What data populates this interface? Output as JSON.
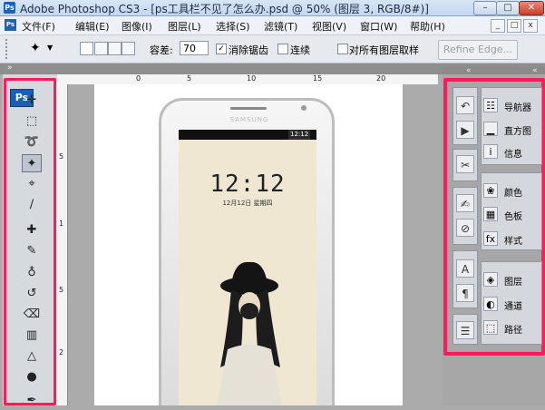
{
  "window": {
    "app_icon": "Ps",
    "title": "Adobe Photoshop CS3 - [ps工具栏不见了怎么办.psd @ 50% (图层 3, RGB/8#)]",
    "controls": [
      "–",
      "□",
      "✕"
    ]
  },
  "menu": {
    "items": [
      "文件(F)",
      "编辑(E)",
      "图像(I)",
      "图层(L)",
      "选择(S)",
      "滤镜(T)",
      "视图(V)",
      "窗口(W)",
      "帮助(H)"
    ],
    "doc_controls": [
      "_",
      "□",
      "x"
    ]
  },
  "options": {
    "tolerance_label": "容差:",
    "tolerance_value": "70",
    "antialias_label": "消除锯齿",
    "antialias_checked": "✓",
    "contiguous_label": "连续",
    "sample_all_label": "对所有图层取样",
    "refine_edge_label": "Refine Edge..."
  },
  "ruler": {
    "top_labels": [
      "0",
      "5",
      "10",
      "15",
      "20"
    ],
    "left_labels": [
      "5",
      "1",
      "5",
      "2"
    ]
  },
  "toolbox": {
    "logo": "Ps",
    "tools": [
      {
        "name": "move-tool-icon",
        "glyph": "✛"
      },
      {
        "name": "marquee-tool-icon",
        "glyph": "⬚"
      },
      {
        "name": "lasso-tool-icon",
        "glyph": "➰"
      },
      {
        "name": "magic-wand-tool-icon",
        "glyph": "✦"
      },
      {
        "name": "crop-tool-icon",
        "glyph": "⌖"
      },
      {
        "name": "slice-tool-icon",
        "glyph": "∕"
      },
      {
        "name": "healing-brush-tool-icon",
        "glyph": "✚"
      },
      {
        "name": "brush-tool-icon",
        "glyph": "✎"
      },
      {
        "name": "clone-stamp-tool-icon",
        "glyph": "♁"
      },
      {
        "name": "history-brush-tool-icon",
        "glyph": "↺"
      },
      {
        "name": "eraser-tool-icon",
        "glyph": "⌫"
      },
      {
        "name": "gradient-tool-icon",
        "glyph": "▥"
      },
      {
        "name": "blur-tool-icon",
        "glyph": "△"
      },
      {
        "name": "dodge-tool-icon",
        "glyph": "●"
      },
      {
        "name": "pen-tool-icon",
        "glyph": "✒"
      }
    ]
  },
  "document": {
    "phone_brand": "SAMSUNG",
    "status_time": "12:12",
    "lock_time": "12:12",
    "lock_date": "12月12日 星期四"
  },
  "panels": {
    "collapse_left": "«",
    "collapse_right": "«",
    "groups": [
      {
        "label": "导航器",
        "icon": "navigator-icon",
        "glyph": "☷"
      },
      {
        "label": "直方图",
        "icon": "histogram-icon",
        "glyph": "▁"
      },
      {
        "label": "信息",
        "icon": "info-icon",
        "glyph": "i"
      },
      {
        "label": "颜色",
        "icon": "color-icon",
        "glyph": "❀"
      },
      {
        "label": "色板",
        "icon": "swatches-icon",
        "glyph": "▦"
      },
      {
        "label": "样式",
        "icon": "styles-icon",
        "glyph": "fx"
      },
      {
        "label": "图层",
        "icon": "layers-icon",
        "glyph": "◈"
      },
      {
        "label": "通道",
        "icon": "channels-icon",
        "glyph": "◐"
      },
      {
        "label": "路径",
        "icon": "paths-icon",
        "glyph": "⬚"
      }
    ],
    "dock_icons": [
      {
        "name": "history-icon",
        "glyph": "↶"
      },
      {
        "name": "actions-icon",
        "glyph": "▶"
      },
      {
        "name": "tool-presets-icon",
        "glyph": "✂"
      },
      {
        "name": "brushes-icon",
        "glyph": "✍"
      },
      {
        "name": "clone-source-icon",
        "glyph": "⊘"
      },
      {
        "name": "character-icon",
        "glyph": "A"
      },
      {
        "name": "paragraph-icon",
        "glyph": "¶"
      },
      {
        "name": "layer-comps-icon",
        "glyph": "☰"
      }
    ]
  },
  "colors": {
    "highlight": "#ff1a5a",
    "ps_blue": "#1a5fb4"
  }
}
